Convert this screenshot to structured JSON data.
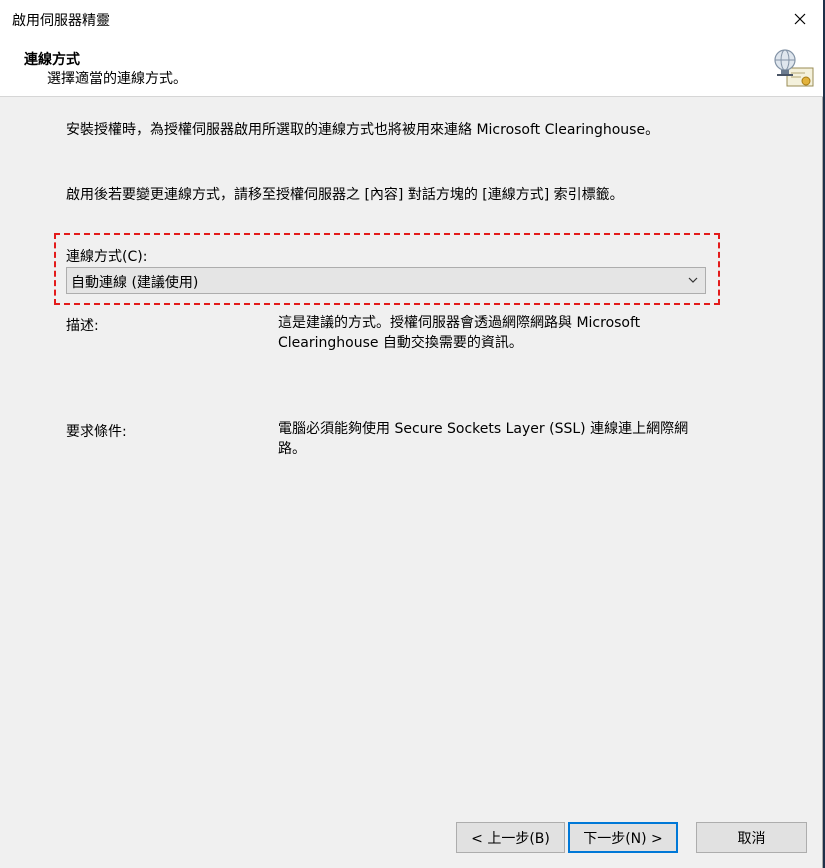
{
  "window": {
    "title": "啟用伺服器精靈"
  },
  "header": {
    "title": "連線方式",
    "subtitle": "選擇適當的連線方式。"
  },
  "intro": {
    "line1": "安裝授權時，為授權伺服器啟用所選取的連線方式也將被用來連絡 Microsoft Clearinghouse。",
    "line2": "啟用後若要變更連線方式，請移至授權伺服器之 [內容] 對話方塊的 [連線方式] 索引標籤。"
  },
  "connection": {
    "label": "連線方式(C):",
    "selected": "自動連線 (建議使用)"
  },
  "description": {
    "label": "描述:",
    "text": "這是建議的方式。授權伺服器會透過網際網路與 Microsoft Clearinghouse 自動交換需要的資訊。"
  },
  "requirements": {
    "label": "要求條件:",
    "text": "電腦必須能夠使用 Secure Sockets Layer (SSL) 連線連上網際網路。"
  },
  "buttons": {
    "back": "< 上一步(B)",
    "next": "下一步(N) >",
    "cancel": "取消"
  }
}
